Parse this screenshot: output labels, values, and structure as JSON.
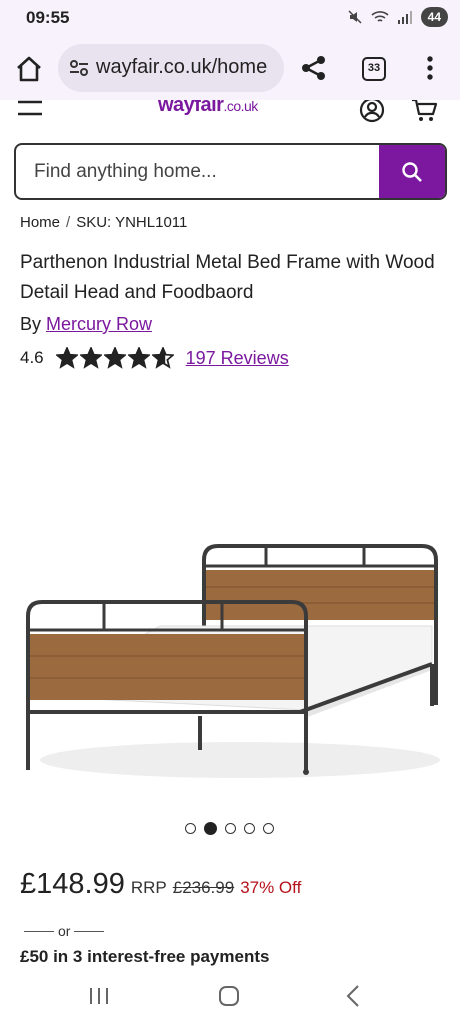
{
  "status_bar": {
    "time": "09:55",
    "battery": "44"
  },
  "browser": {
    "url": "wayfair.co.uk/home",
    "tab_count": "33"
  },
  "site": {
    "logo": "wayfair",
    "logo_suffix": ".co.uk"
  },
  "search": {
    "placeholder": "Find anything home..."
  },
  "breadcrumb": {
    "home": "Home",
    "sep": "/",
    "sku": "SKU: YNHL1011"
  },
  "product": {
    "title": "Parthenon Industrial Metal Bed Frame with Wood Detail Head and Foodbaord",
    "by_label": "By",
    "brand": "Mercury Row",
    "rating": "4.6",
    "rating_value": 4.6,
    "rating_max": 5,
    "reviews": "197 Reviews"
  },
  "carousel": {
    "count": 5,
    "active_index": 1
  },
  "pricing": {
    "price": "£148.99",
    "rrp_label": "RRP",
    "rrp": "£236.99",
    "discount": "37% Off",
    "or": "or",
    "installments": "£50 in 3 interest-free payments"
  },
  "colors": {
    "brand": "#7b189f",
    "discount": "#b5121b"
  },
  "icons": [
    "home-icon",
    "tune-icon",
    "share-icon",
    "tabs-icon",
    "more-vert-icon",
    "hamburger-icon",
    "account-icon",
    "cart-icon",
    "search-icon",
    "star-icon",
    "star-half-icon",
    "recents-icon",
    "nav-home-icon",
    "back-icon"
  ]
}
